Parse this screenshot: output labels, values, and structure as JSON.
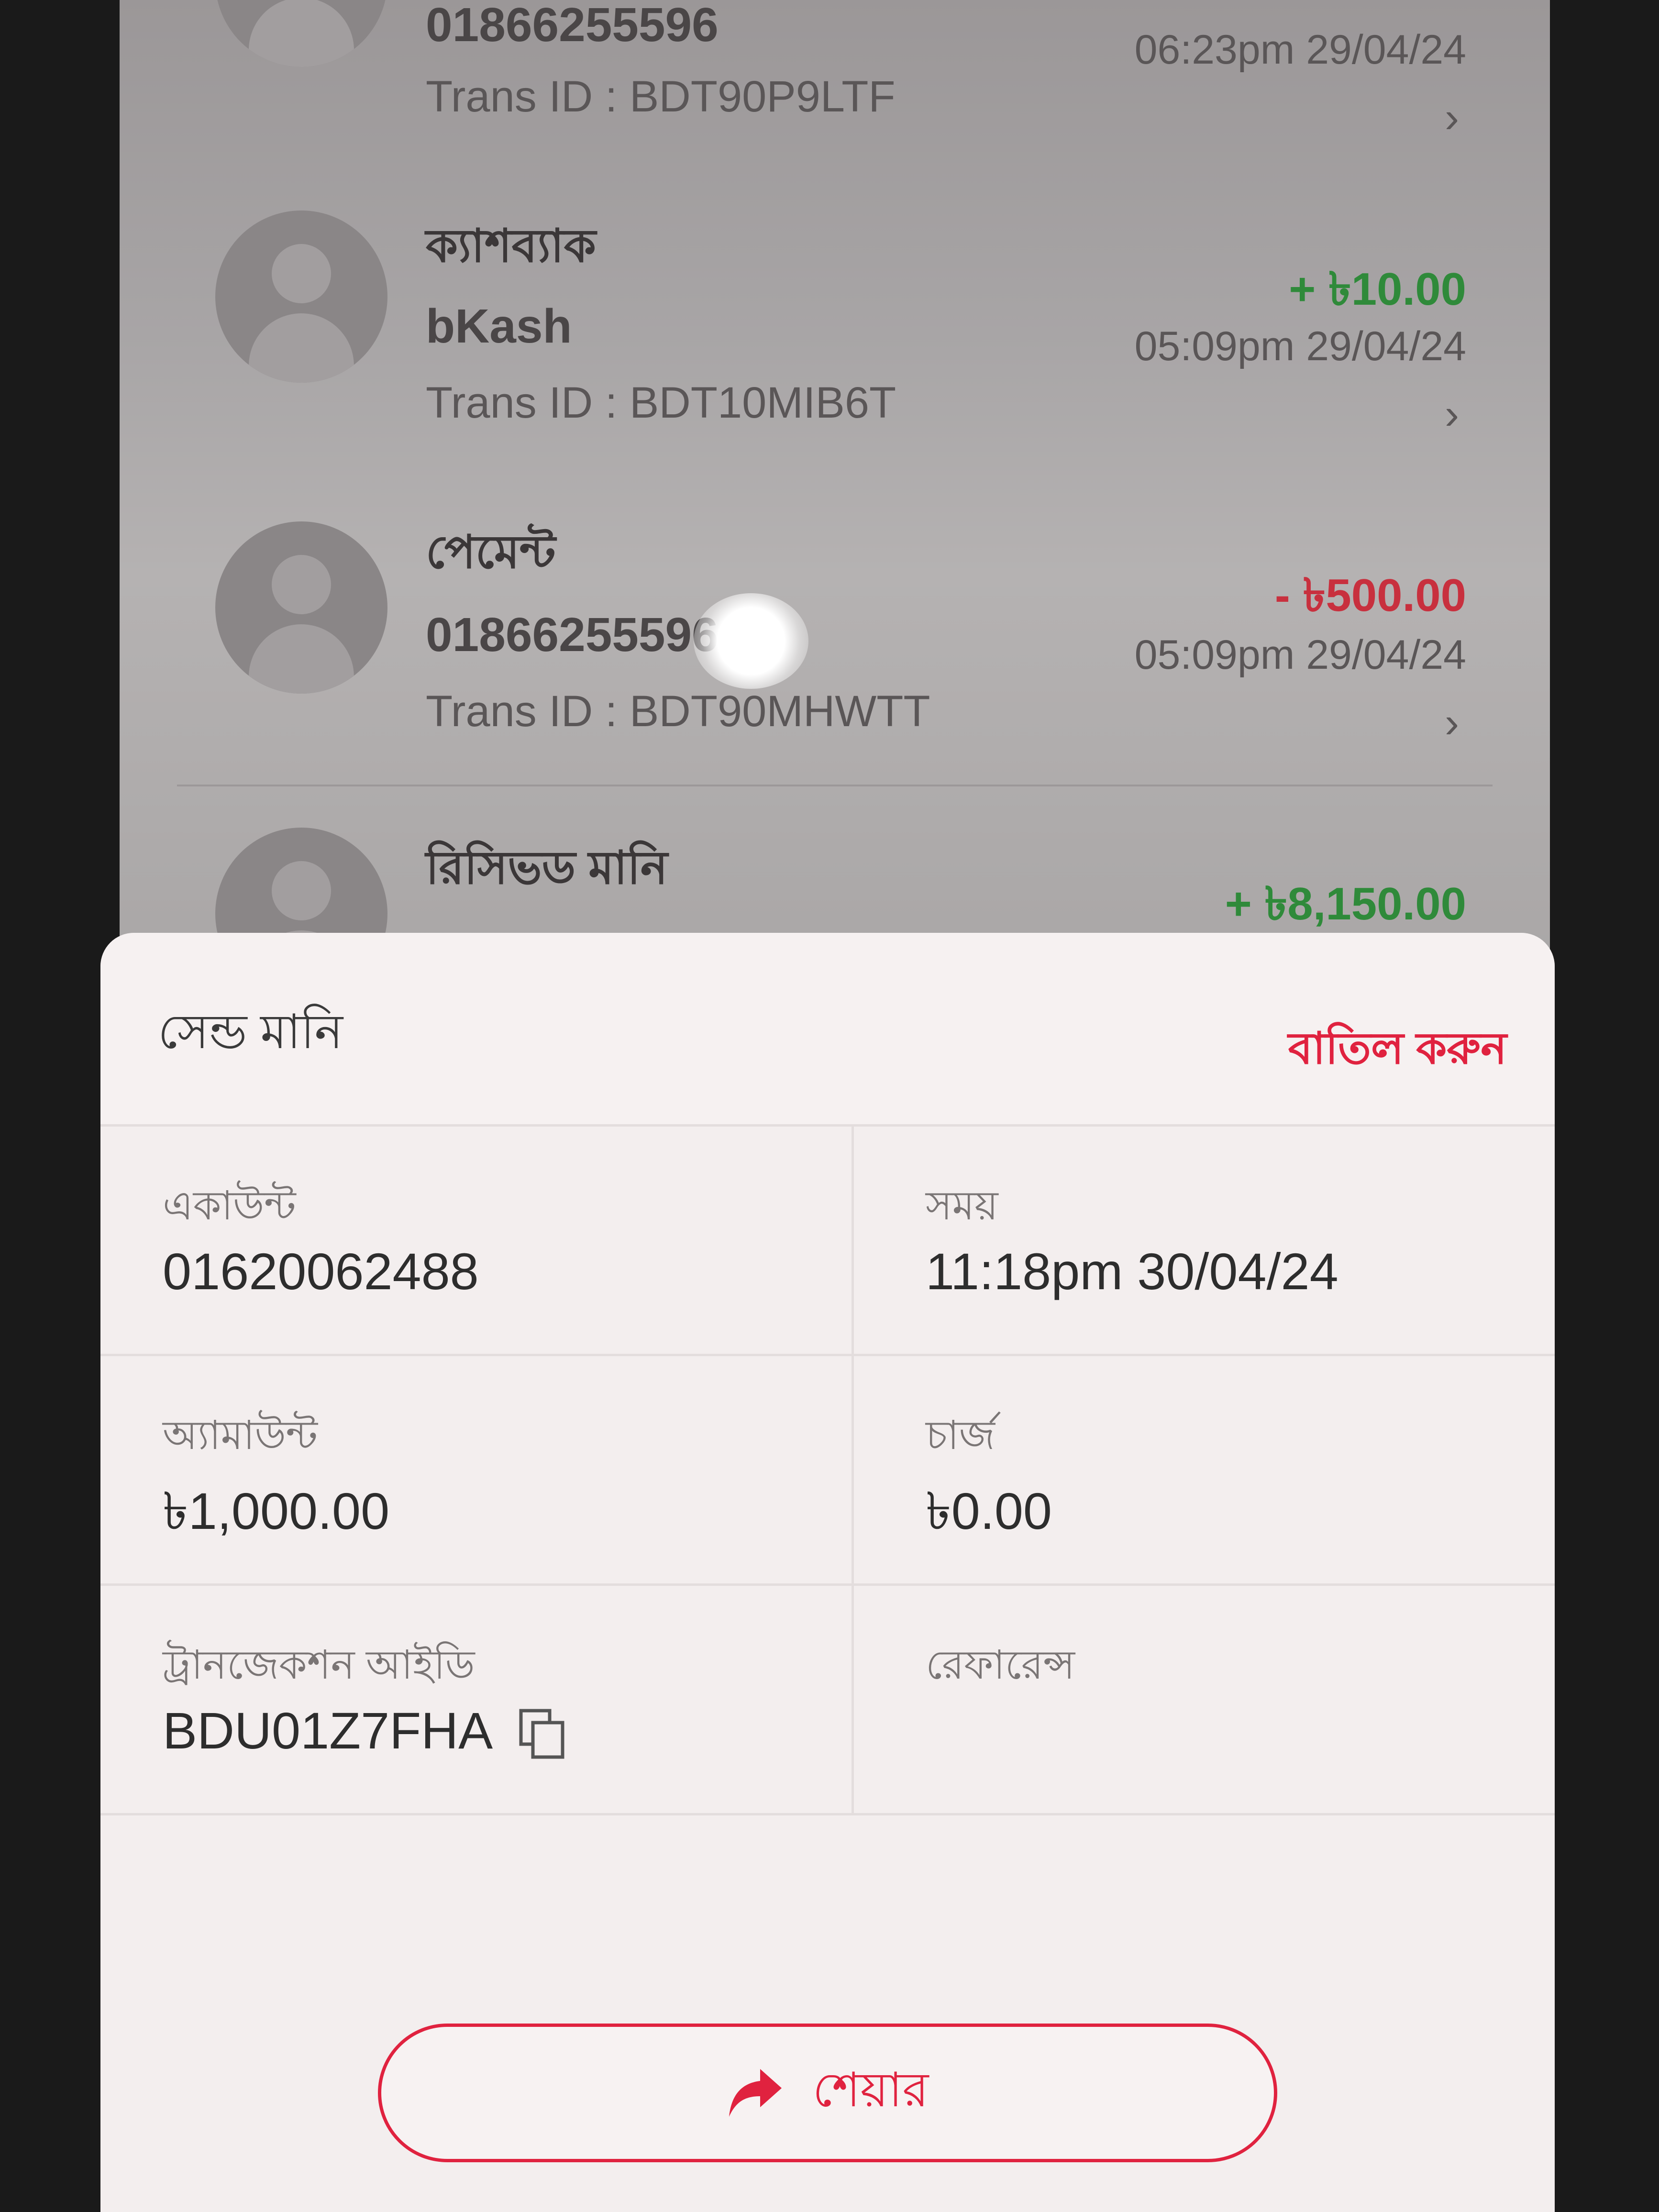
{
  "transactions": [
    {
      "type": "",
      "number": "01866255596",
      "trans_id": "Trans ID : BDT90P9LTF",
      "amount": "",
      "time": "06:23pm 29/04/24"
    },
    {
      "type": "ক্যাশব্যাক",
      "number": "bKash",
      "trans_id": "Trans ID : BDT10MIB6T",
      "amount": "+ ৳10.00",
      "time": "05:09pm 29/04/24"
    },
    {
      "type": "পেমেন্ট",
      "number": "01866255596",
      "trans_id": "Trans ID : BDT90MHWTT",
      "amount": "- ৳500.00",
      "time": "05:09pm 29/04/24"
    },
    {
      "type": "রিসিভড মানি",
      "number": "",
      "trans_id": "",
      "amount": "+ ৳8,150.00",
      "time": ""
    }
  ],
  "sheet": {
    "title": "সেন্ড মানি",
    "cancel_label": "বাতিল করুন",
    "account_label": "একাউন্ট",
    "account_value": "01620062488",
    "time_label": "সময়",
    "time_value": "11:18pm 30/04/24",
    "amount_label": "অ্যামাউন্ট",
    "amount_value": "৳1,000.00",
    "charge_label": "চার্জ",
    "charge_value": "৳0.00",
    "trxid_label": "ট্রানজেকশন আইডি",
    "trxid_value": "BDU01Z7FHA",
    "reference_label": "রেফারেন্স",
    "reference_value": "",
    "share_label": "শেয়ার"
  },
  "icons": {
    "chevron": "chevron-right-icon",
    "copy": "copy-icon",
    "share": "share-arrow-icon",
    "avatar": "user-avatar-icon"
  },
  "colors": {
    "accent": "#e0223f",
    "positive": "#2f8a3a",
    "negative": "#c8303e"
  }
}
